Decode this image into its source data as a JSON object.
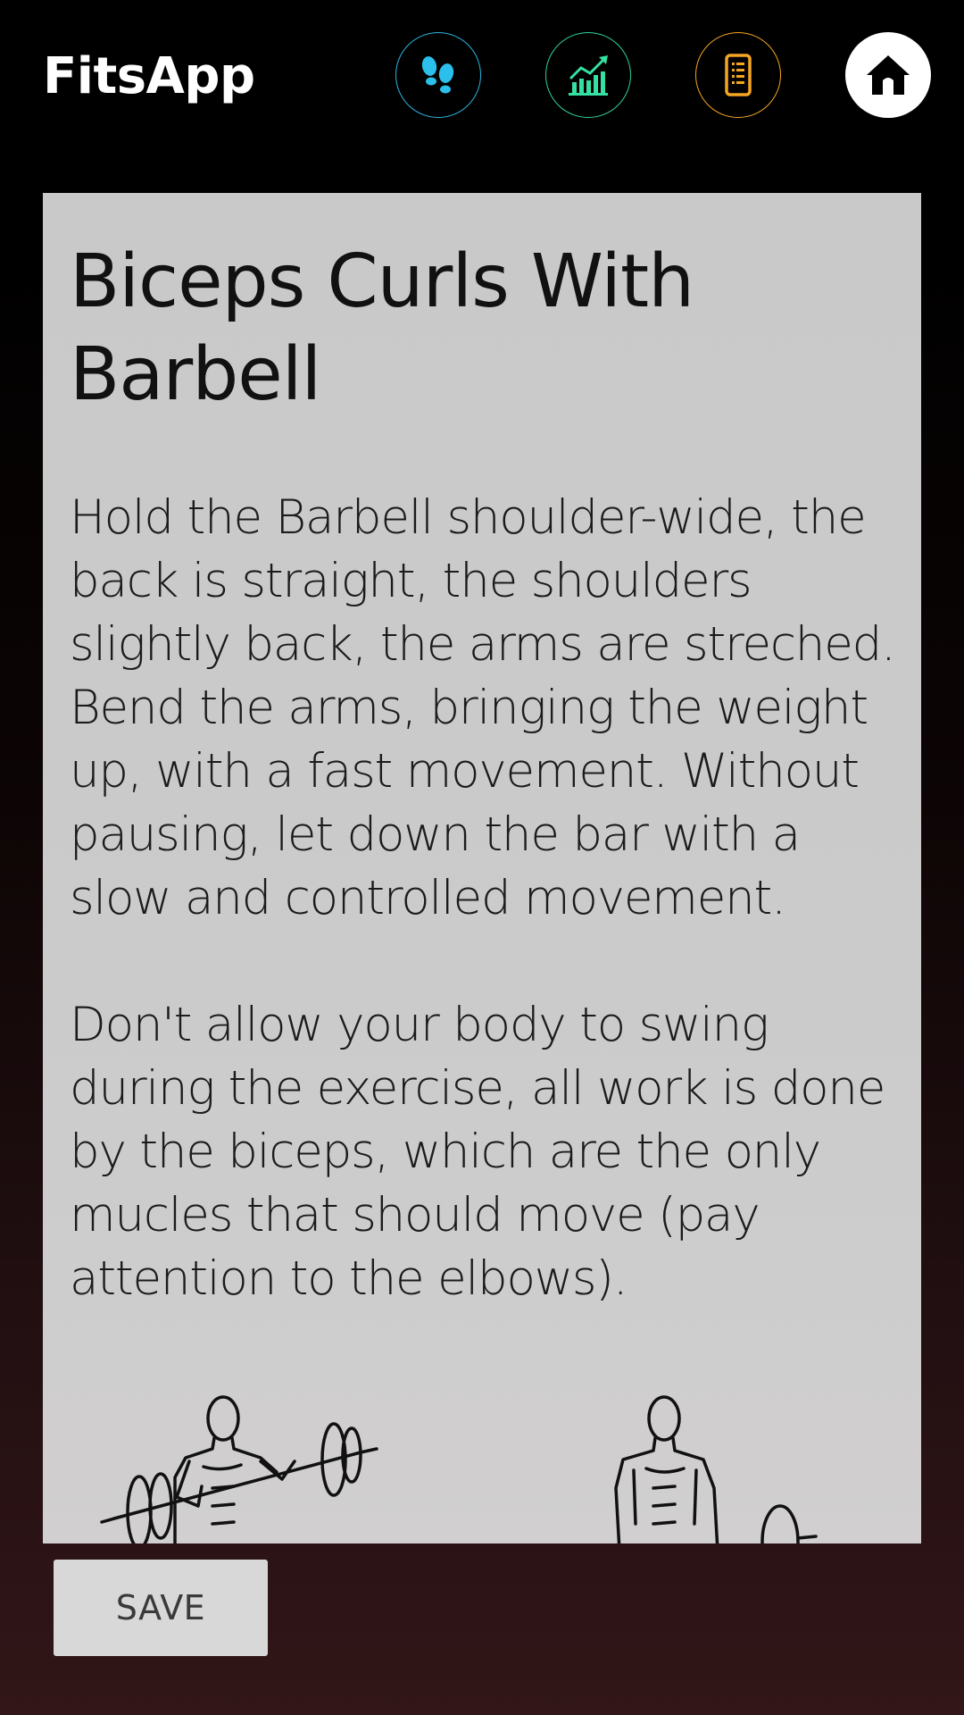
{
  "header": {
    "app_title": "FitsApp",
    "nav": [
      {
        "name": "steps",
        "icon": "footsteps-icon",
        "color": "#29b6e0"
      },
      {
        "name": "stats",
        "icon": "chart-icon",
        "color": "#2fd39a"
      },
      {
        "name": "list",
        "icon": "list-icon",
        "color": "#f4a623"
      },
      {
        "name": "home",
        "icon": "home-icon",
        "color": "#ffffff"
      }
    ]
  },
  "exercise": {
    "title": "Biceps Curls With Barbell",
    "description": "Hold the Barbell shoulder-wide, the back is straight, the shoulders slightly back, the arms are streched. Bend the arms, bringing the weight up, with a fast movement. Without pausing, let down the bar with a slow and controlled movement.\n\nDon't allow your body to swing during the exercise, all work is done by the biceps, which are the only mucles that should move (pay attention to the elbows).",
    "illustration": "barbell-curl-illustration"
  },
  "actions": {
    "save_label": "SAVE"
  }
}
